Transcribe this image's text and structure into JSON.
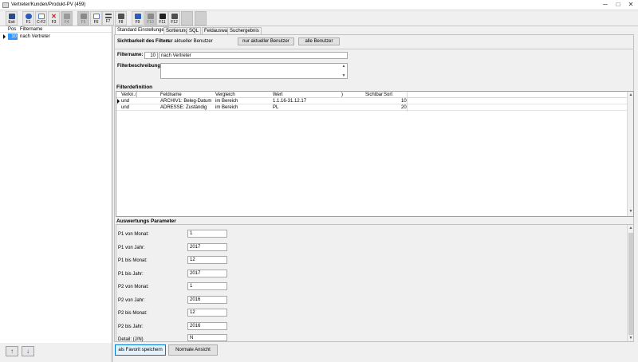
{
  "window": {
    "title": "Vertreter/Kunden/Produkt-PV (459)",
    "controls": {
      "minimize": "─",
      "maximize": "□",
      "close": "✕"
    }
  },
  "toolbar": {
    "buttons": [
      {
        "label": "Exit",
        "icon": "exit-icon",
        "color": "#2c4a8a",
        "enabled": true
      },
      {
        "label": "F1",
        "icon": "help-icon",
        "color": "#2a5cc0",
        "enabled": true
      },
      {
        "label": "C-F2",
        "icon": "new-document-icon",
        "color": "#4a7ad0",
        "enabled": true
      },
      {
        "label": "F3",
        "icon": "delete-icon",
        "color": "#d02020",
        "enabled": true
      },
      {
        "label": "F4",
        "icon": "save-icon",
        "color": "#9a9a9a",
        "enabled": false
      },
      {
        "label": "F5",
        "icon": "binoculars-icon",
        "color": "#8a8a8a",
        "enabled": false
      },
      {
        "label": "F6",
        "icon": "copy-icon",
        "color": "#5a7ac8",
        "enabled": true
      },
      {
        "label": "F7",
        "icon": "list-icon",
        "color": "#505050",
        "enabled": true
      },
      {
        "label": "F8",
        "icon": "print-icon",
        "color": "#505050",
        "enabled": true
      },
      {
        "label": "F9",
        "icon": "filter-icon",
        "color": "#2a5cc0",
        "enabled": true
      },
      {
        "label": "F10",
        "icon": "key-icon",
        "color": "#8a8a8a",
        "enabled": false
      },
      {
        "label": "F11",
        "icon": "grid-icon",
        "color": "#202020",
        "enabled": true
      },
      {
        "label": "F12",
        "icon": "printer-setup-icon",
        "color": "#505050",
        "enabled": true
      }
    ]
  },
  "left_panel": {
    "headers": {
      "pos": "Pos",
      "name": "Filtername"
    },
    "rows": [
      {
        "pos": "10",
        "name": "nach Vertreter"
      }
    ],
    "up_arrow": "↑",
    "down_arrow": "↓"
  },
  "tabs": [
    {
      "label": "Standard Einstellungen",
      "active": true
    },
    {
      "label": "Sortierung",
      "active": false
    },
    {
      "label": "SQL",
      "active": false
    },
    {
      "label": "Feldauswahl",
      "active": false
    },
    {
      "label": "Suchergebnis",
      "active": false
    }
  ],
  "visibility": {
    "label": "Sichtbarkeit des Filters:",
    "value": "nur aktueller Benutzer",
    "btn_current_user": "nur aktueller Benutzer",
    "btn_all_users": "alle Benutzer"
  },
  "filter": {
    "name_label": "Filtername:",
    "number": "10",
    "name": "nach Vertreter",
    "description_label": "Filterbeschreibung:",
    "description": ""
  },
  "definition": {
    "title": "Filterdefinition",
    "headers": [
      "Verkn.",
      "(",
      "Feldname",
      "Vergleich",
      "Wert",
      ")",
      "Sichtbar",
      "Sort"
    ],
    "rows": [
      {
        "verkn": "und",
        "open": "",
        "feld": "ARCHIV1: Beleg-Datum",
        "vergleich": "im Bereich",
        "wert": "1.1.16-31.12.17",
        "close": "",
        "sichtbar": "",
        "sort": "10"
      },
      {
        "verkn": "und",
        "open": "",
        "feld": "ADRESSE: Zuständig",
        "vergleich": "im Bereich",
        "wert": "PL",
        "close": "",
        "sichtbar": "",
        "sort": "20"
      }
    ]
  },
  "params": {
    "title": "Auswertungs Parameter",
    "items": [
      {
        "label": "P1 von Monat:",
        "value": "1"
      },
      {
        "label": "P1 von Jahr:",
        "value": "2017"
      },
      {
        "label": "P1 bis Monat:",
        "value": "12"
      },
      {
        "label": "P1 bis Jahr:",
        "value": "2017"
      },
      {
        "label": "P2 von Monat:",
        "value": "1"
      },
      {
        "label": "P2 von Jahr:",
        "value": "2016"
      },
      {
        "label": "P2 bis Monat:",
        "value": "12"
      },
      {
        "label": "P2 bis Jahr:",
        "value": "2016"
      },
      {
        "label": "Detail: (J/N)",
        "value": "N"
      }
    ]
  },
  "footer": {
    "save_favorite": "als Favorit speichern",
    "normal_view": "Normale Ansicht"
  },
  "scroll": {
    "up": "▲",
    "down": "▼"
  }
}
